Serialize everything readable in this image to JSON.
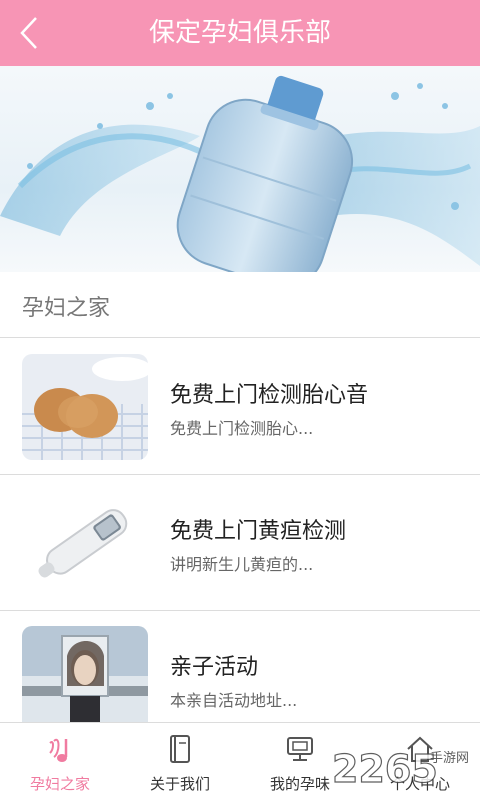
{
  "header": {
    "title": "保定孕妇俱乐部"
  },
  "section": {
    "title": "孕妇之家"
  },
  "items": [
    {
      "title": "免费上门检测胎心音",
      "desc": "免费上门检测胎心..."
    },
    {
      "title": "免费上门黄疸检测",
      "desc": "讲明新生儿黄疸的..."
    },
    {
      "title": "亲子活动",
      "desc": "本亲自活动地址..."
    }
  ],
  "tabs": [
    {
      "label": "孕妇之家",
      "icon": "music-note-icon",
      "active": true
    },
    {
      "label": "关于我们",
      "icon": "book-icon",
      "active": false
    },
    {
      "label": "我的孕味",
      "icon": "monitor-icon",
      "active": false
    },
    {
      "label": "个人中心",
      "icon": "home-icon",
      "active": false
    }
  ],
  "watermark": {
    "text": "2265",
    "sub": "手游网"
  },
  "colors": {
    "header": "#f795b5",
    "active_tab": "#f07ba0"
  }
}
